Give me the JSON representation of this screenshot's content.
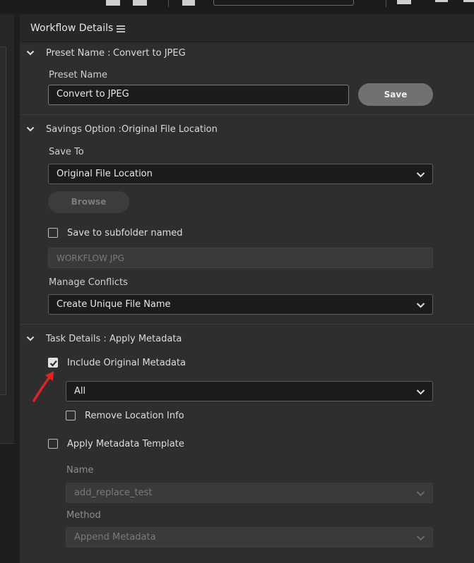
{
  "panel": {
    "title": "Workflow Details"
  },
  "preset": {
    "section_label": "Preset Name :",
    "section_value": "Convert to JPEG",
    "field_label": "Preset Name",
    "field_value": "Convert to JPEG",
    "save_label": "Save"
  },
  "savings": {
    "section_label": "Savings Option :",
    "section_value": "Original File Location",
    "save_to_label": "Save To",
    "save_to_value": "Original File Location",
    "browse_label": "Browse",
    "subfolder_label": "Save to subfolder named",
    "subfolder_checked": false,
    "subfolder_value": "WORKFLOW JPG",
    "conflicts_label": "Manage Conflicts",
    "conflicts_value": "Create Unique File Name"
  },
  "task": {
    "section_label": "Task Details :",
    "section_value": "Apply Metadata",
    "include_label": "Include Original Metadata",
    "include_checked": true,
    "include_scope_value": "All",
    "remove_location_label": "Remove Location Info",
    "remove_location_checked": false,
    "apply_template_label": "Apply Metadata Template",
    "apply_template_checked": false,
    "name_label": "Name",
    "name_value": "add_replace_test",
    "method_label": "Method",
    "method_value": "Append Metadata"
  },
  "colors": {
    "background": "#1e1e1e",
    "panel": "#2e2e2e",
    "annotation_arrow": "#e52222"
  },
  "icons": [
    "menu-icon",
    "chevron-down-icon",
    "checkbox-icon",
    "checkmark-icon",
    "red-arrow-annotation"
  ]
}
